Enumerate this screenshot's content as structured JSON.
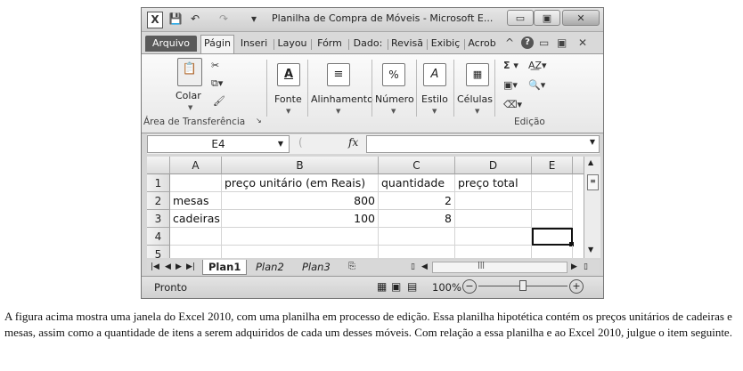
{
  "window": {
    "title": "Planilha de Compra de Móveis  -  Microsoft E...",
    "buttons": {
      "minimize": "▭",
      "restore": "▣",
      "close": "✕"
    }
  },
  "quick_access": {
    "excel_icon": "X",
    "save_icon": "💾",
    "undo_icon": "↶",
    "redo_icon": "↷",
    "customize_icon": "▾"
  },
  "tabs": [
    {
      "label": "Arquivo"
    },
    {
      "label": "Págin"
    },
    {
      "label": "Inseri"
    },
    {
      "label": "Layou"
    },
    {
      "label": "Fórm"
    },
    {
      "label": "Dado:"
    },
    {
      "label": "Revisã"
    },
    {
      "label": "Exibiç"
    },
    {
      "label": "Acrob"
    }
  ],
  "ribbon": {
    "clipboard": {
      "paste_label": "Colar",
      "group_label": "Área de Transferência"
    },
    "font": {
      "label": "Fonte"
    },
    "alignment": {
      "label": "Alinhamento"
    },
    "number": {
      "label": "Número"
    },
    "style": {
      "label": "Estilo"
    },
    "cells": {
      "label": "Células"
    },
    "editing": {
      "group_label": "Edição"
    }
  },
  "formula_bar": {
    "name_box": "E4",
    "fx": "fx",
    "formula": ""
  },
  "sheet": {
    "columns": [
      "A",
      "B",
      "C",
      "D",
      "E"
    ],
    "rows": [
      "1",
      "2",
      "3",
      "4",
      "5"
    ],
    "cells": {
      "B1": "preço unitário (em Reais)",
      "C1": "quantidade",
      "D1": "preço total",
      "A2": "mesas",
      "B2": "800",
      "C2": "2",
      "A3": "cadeiras",
      "B3": "100",
      "C3": "8"
    },
    "selected_cell": "E4"
  },
  "sheet_tabs": [
    {
      "label": "Plan1"
    },
    {
      "label": "Plan2"
    },
    {
      "label": "Plan3"
    }
  ],
  "status": {
    "mode": "Pronto",
    "zoom": "100%"
  },
  "caption": "A figura acima mostra uma janela do Excel 2010, com uma planilha em processo de edição. Essa planilha hipotética contém os preços unitários de cadeiras e mesas, assim como a quantidade de itens a serem adquiridos de cada um desses móveis. Com relação a essa planilha e ao Excel 2010, julgue o item seguinte."
}
